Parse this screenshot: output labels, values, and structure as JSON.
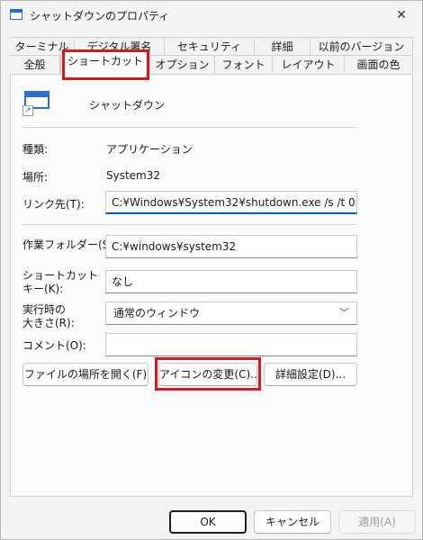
{
  "window": {
    "title": "シャットダウンのプロパティ",
    "close_symbol": "✕"
  },
  "tabs": {
    "row1": [
      "ターミナル",
      "デジタル署名",
      "セキュリティ",
      "詳細",
      "以前のバージョン"
    ],
    "row2": [
      "全般",
      "ショートカット",
      "オプション",
      "フォント",
      "レイアウト",
      "画面の色"
    ],
    "selected": "ショートカット"
  },
  "shortcut": {
    "name": "シャットダウン",
    "type_label": "種類:",
    "type_value": "アプリケーション",
    "location_label": "場所:",
    "location_value": "System32",
    "target_label": "リンク先(T):",
    "target_value": "C:¥Windows¥System32¥shutdown.exe /s /t 0",
    "startin_label": "作業フォルダー(S):",
    "startin_value": "C:¥windows¥system32",
    "hotkey_label_1": "ショートカット",
    "hotkey_label_2": "キー(K):",
    "hotkey_value": "なし",
    "run_label_1": "実行時の",
    "run_label_2": "大きさ(R):",
    "run_value": "通常のウィンドウ",
    "comment_label": "コメント(O):",
    "comment_value": ""
  },
  "buttons": {
    "open_location": "ファイルの場所を開く(F)",
    "change_icon": "アイコンの変更(C)...",
    "advanced": "詳細設定(D)..."
  },
  "footer": {
    "ok": "OK",
    "cancel": "キャンセル",
    "apply": "適用(A)"
  },
  "icons": {
    "chevron": "﹀",
    "shortcut_arrow": "↗"
  },
  "highlight_color": "#d8191c"
}
